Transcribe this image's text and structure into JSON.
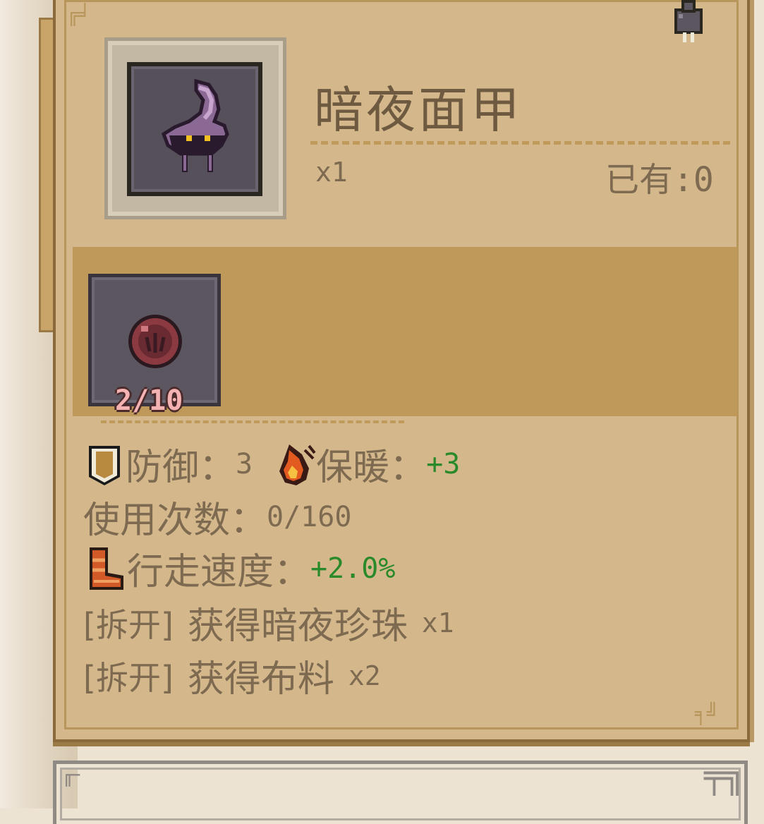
{
  "item": {
    "name": "暗夜面甲",
    "quantity": "x1",
    "owned": "已有:0"
  },
  "gem_slot": {
    "count": "2/10"
  },
  "stats": {
    "defense_label": "防御：",
    "defense_value": "3",
    "warmth_label": "保暖：",
    "warmth_value": "+3",
    "uses_label": "使用次数：",
    "uses_value": "0/160",
    "speed_label": "行走速度：",
    "speed_value": "+2.0%"
  },
  "disassemble": [
    {
      "tag": "[拆开]",
      "text": "获得暗夜珍珠",
      "count": "x1"
    },
    {
      "tag": "[拆开]",
      "text": "获得布料",
      "count": "x2"
    }
  ],
  "colors": {
    "panel": "#d4b88c",
    "band": "#bf995a",
    "text": "#7d6a50",
    "positive": "#2a8a2a",
    "slot": "#5c5660"
  },
  "icons": {
    "item": "dark-night-mask-icon",
    "gem": "dark-pearl-icon",
    "defense": "shield-icon",
    "warmth": "fire-icon",
    "speed": "boot-icon",
    "pin": "pin-icon"
  }
}
